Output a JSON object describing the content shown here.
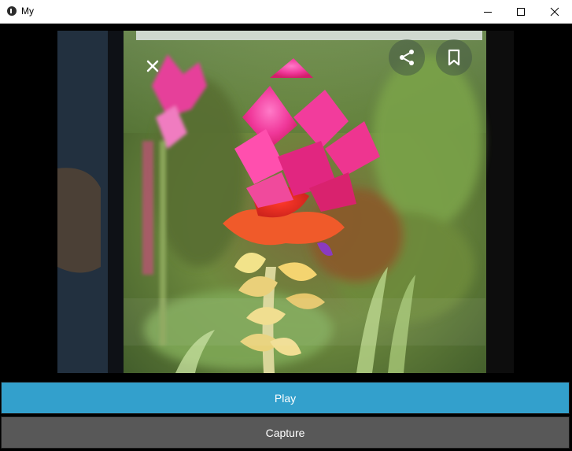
{
  "window": {
    "title": "My",
    "minimize_icon": "minimize-icon",
    "maximize_icon": "maximize-icon",
    "close_icon": "close-icon"
  },
  "camera_view": {
    "overlay_icons": [
      "close-icon",
      "share-icon",
      "bookmark-icon"
    ]
  },
  "buttons": {
    "play_label": "Play",
    "capture_label": "Capture"
  },
  "colors": {
    "play_button": "#33a0cc",
    "capture_button": "#585858",
    "background": "#000000"
  }
}
